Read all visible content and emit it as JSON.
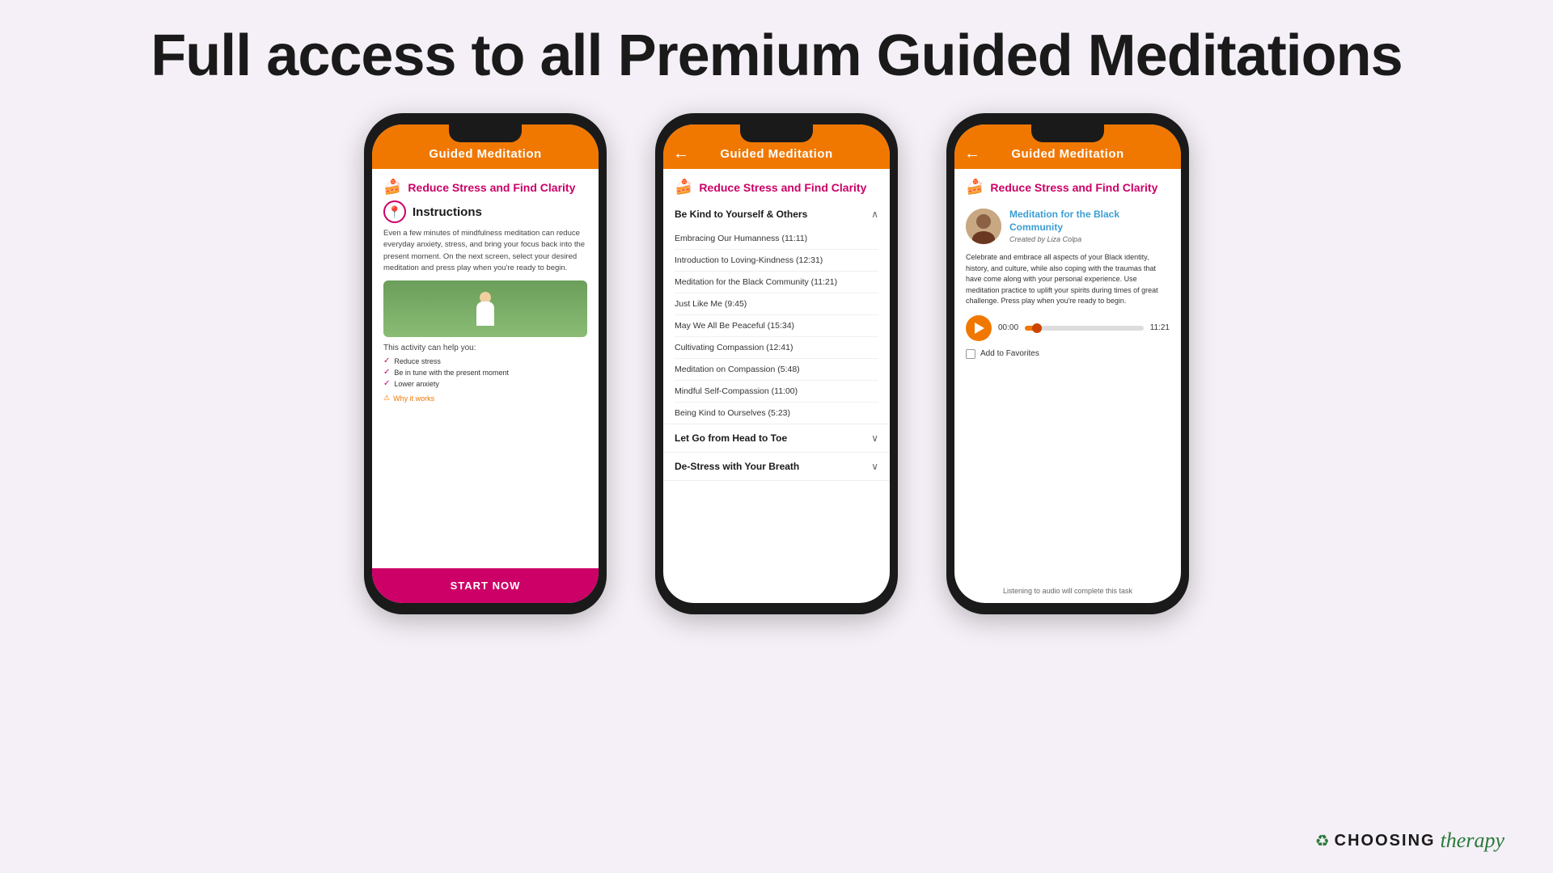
{
  "page": {
    "title": "Full access to all Premium Guided Meditations",
    "background": "#f5f0f7"
  },
  "phone1": {
    "header": "Guided Meditation",
    "category_icon": "🍰",
    "category_title": "Reduce Stress and Find Clarity",
    "instructions_label": "Instructions",
    "instructions_text": "Even a few minutes of mindfulness meditation can reduce everyday anxiety, stress, and bring your focus back into the present moment. On the next screen, select your desired meditation and press play when you're ready to begin.",
    "activity_title": "This activity can help you:",
    "benefits": [
      "Reduce stress",
      "Be in tune with the present moment",
      "Lower anxiety"
    ],
    "why_label": "Why it works",
    "start_button": "START NOW"
  },
  "phone2": {
    "header": "Guided Meditation",
    "category_icon": "🍰",
    "category_title": "Reduce Stress and Find Clarity",
    "section1": {
      "title": "Be Kind to Yourself & Others",
      "expanded": true,
      "items": [
        "Embracing Our Humanness (11:11)",
        "Introduction to Loving-Kindness (12:31)",
        "Meditation for the Black Community (11:21)",
        "Just Like Me (9:45)",
        "May We All Be Peaceful (15:34)",
        "Cultivating Compassion (12:41)",
        "Meditation on Compassion (5:48)",
        "Mindful Self-Compassion (11:00)",
        "Being Kind to Ourselves (5:23)"
      ]
    },
    "section2": {
      "title": "Let Go from Head to Toe",
      "expanded": false
    },
    "section3": {
      "title": "De-Stress with Your Breath",
      "expanded": false
    }
  },
  "phone3": {
    "header": "Guided Meditation",
    "category_icon": "🍰",
    "category_title": "Reduce Stress and Find Clarity",
    "meditation_title": "Meditation for the Black Community",
    "created_by": "Created by",
    "author": "Liza Colpa",
    "description": "Celebrate and embrace all aspects of your Black identity, history, and culture, while also coping with the traumas that have come along with your personal experience. Use meditation practice to uplift your spirits during times of great challenge. Press play when you're ready to begin.",
    "time_start": "00:00",
    "time_end": "11:21",
    "add_favorites": "Add to Favorites",
    "listening_note": "Listening to audio will complete this task"
  },
  "branding": {
    "icon": "♻",
    "text": "CHOOSING",
    "script": "therapy"
  }
}
